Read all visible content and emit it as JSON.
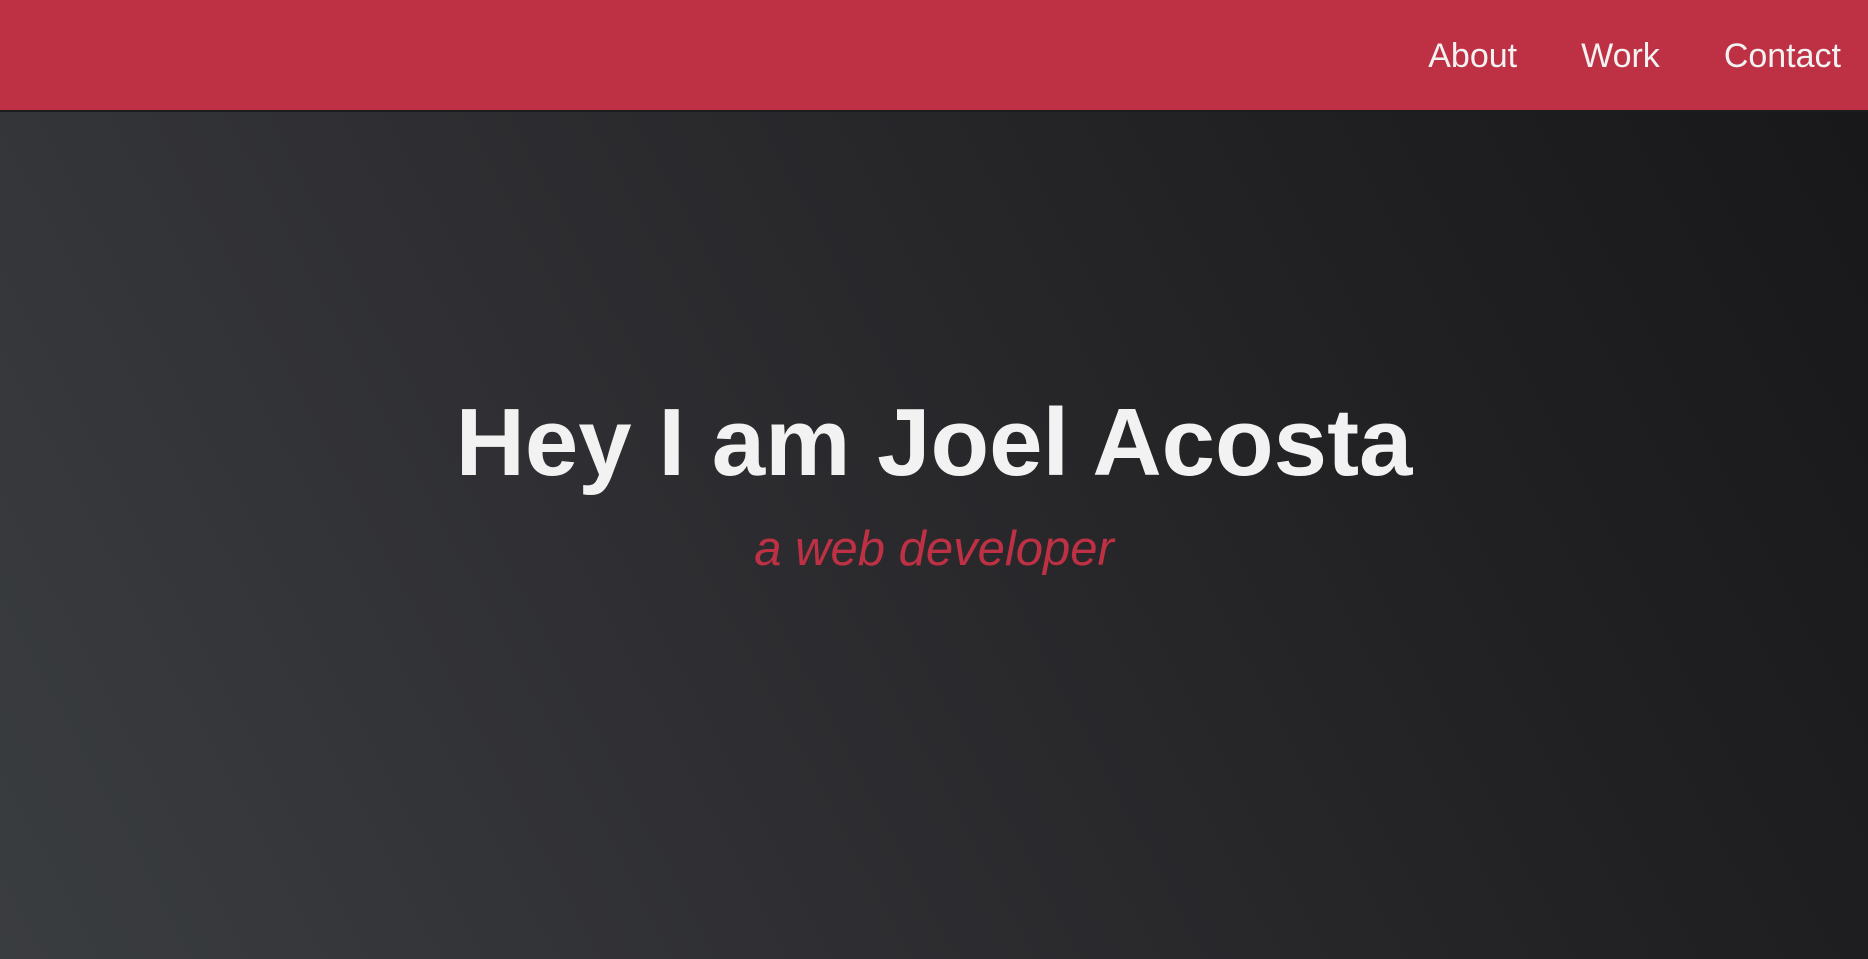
{
  "nav": {
    "items": [
      {
        "label": "About"
      },
      {
        "label": "Work"
      },
      {
        "label": "Contact"
      }
    ]
  },
  "hero": {
    "title": "Hey I am Joel Acosta",
    "subtitle": "a web developer"
  },
  "colors": {
    "accent": "#be3144",
    "text_light": "#f2f2f2",
    "background_dark": "#2a2b2e"
  }
}
